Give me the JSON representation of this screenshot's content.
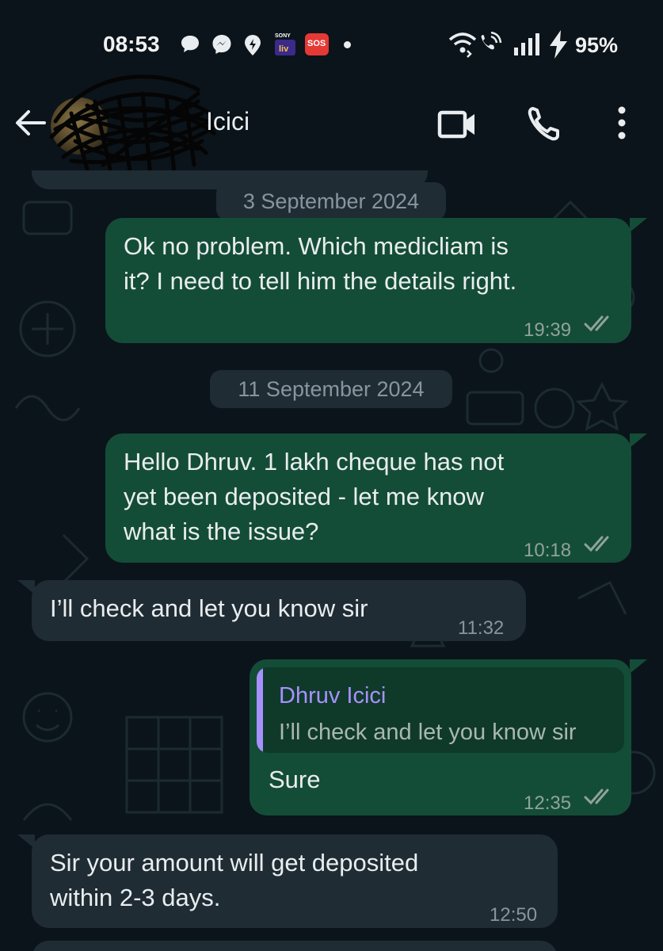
{
  "status_bar": {
    "time": "08:53",
    "battery": "95%",
    "icons": [
      "chat-bubble-icon",
      "messenger-icon",
      "notification-icon",
      "sony-liv-icon",
      "sos-icon",
      "wifi-calling-icon",
      "signal-icon",
      "charging-icon"
    ],
    "sos_label": "SOS"
  },
  "header": {
    "contact_name": "Icici",
    "icons": [
      "back-arrow-icon",
      "video-call-icon",
      "voice-call-icon",
      "more-options-icon"
    ]
  },
  "chat": {
    "date_separators": [
      "3 September 2024",
      "11 September 2024"
    ],
    "messages": [
      {
        "direction": "out",
        "lines": [
          "Ok no problem. Which medicliam is",
          "it? I need to tell him the details right."
        ],
        "time": "19:39",
        "status": "read"
      },
      {
        "direction": "out",
        "lines": [
          "Hello Dhruv. 1 lakh cheque has not",
          "yet been deposited - let me know",
          "what is the issue?"
        ],
        "time": "10:18",
        "status": "read"
      },
      {
        "direction": "in",
        "lines": [
          "I’ll check and let you know sir"
        ],
        "time": "11:32"
      },
      {
        "direction": "out",
        "reply_to": {
          "name": "Dhruv Icici",
          "text": "I’ll check and let you know sir"
        },
        "lines": [
          "Sure"
        ],
        "time": "12:35",
        "status": "read"
      },
      {
        "direction": "in",
        "lines": [
          "Sir your amount will get deposited",
          "within 2-3 days."
        ],
        "time": "12:50"
      }
    ]
  },
  "colors": {
    "background": "#0b141a",
    "outgoing_bubble": "#144d37",
    "incoming_bubble": "#1f2c34",
    "reply_accent": "#a791ff",
    "meta_text": "#8696a0",
    "sos_badge": "#e53935"
  }
}
